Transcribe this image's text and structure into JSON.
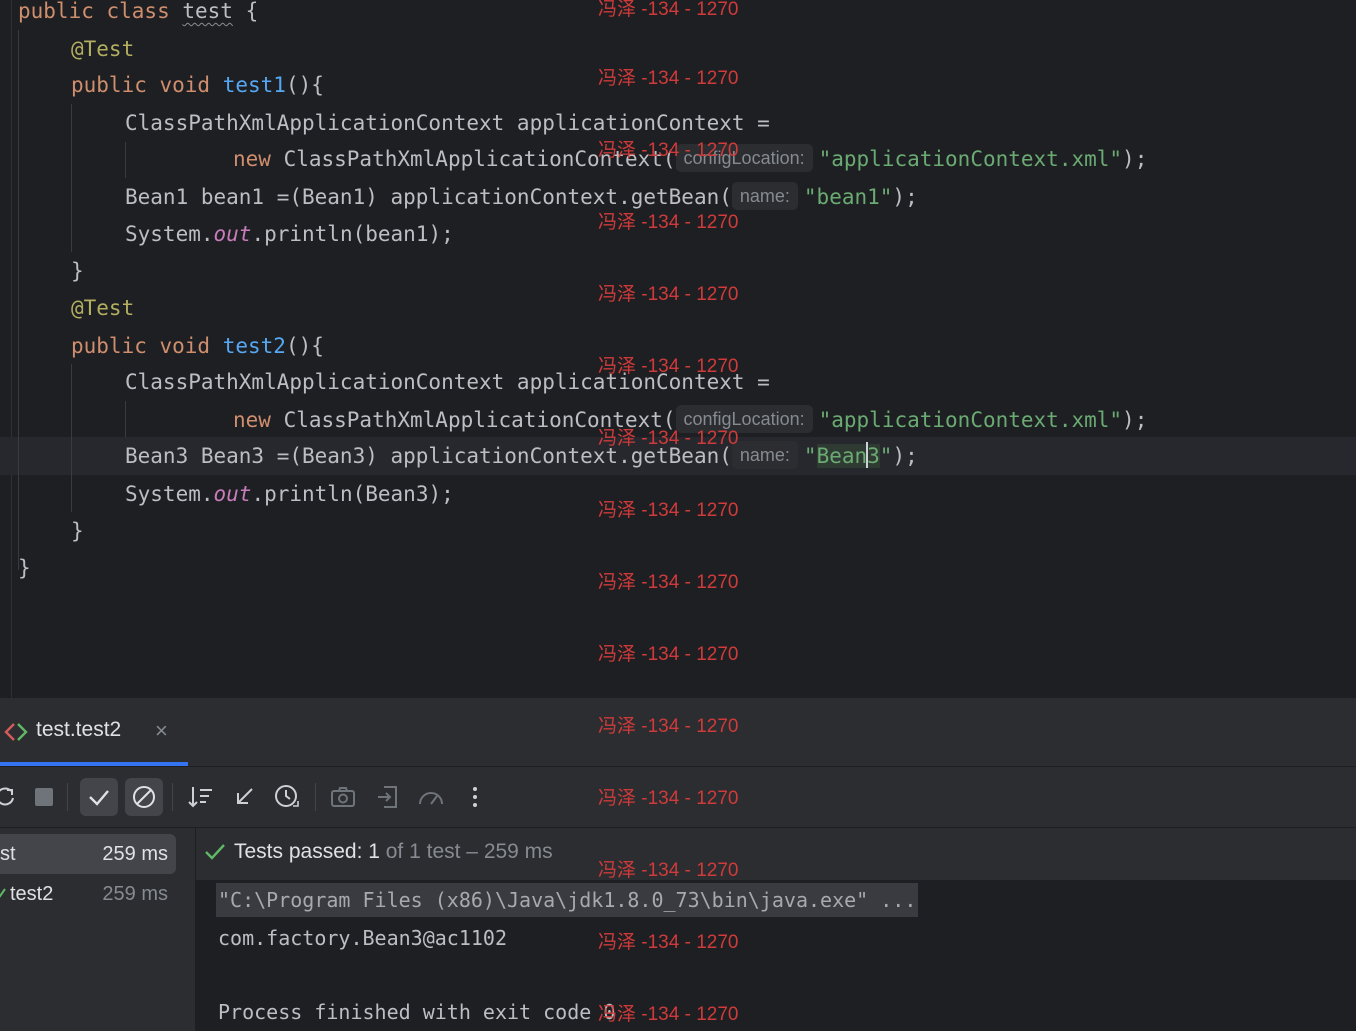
{
  "editor": {
    "class_line": {
      "kw": "public class ",
      "name": "test",
      "rest": " {"
    },
    "method1": {
      "annotation": "@Test",
      "sig_kw": "public void ",
      "sig_name": "test1",
      "sig_rest": "(){",
      "decl": "ClassPathXmlApplicationContext applicationContext =",
      "new_kw": "new ",
      "new_rest": "ClassPathXmlApplicationContext(",
      "hint_config": "configLocation:",
      "config_str": "\"applicationContext.xml\"",
      "stmt_end": ");",
      "getbean_pre": "Bean1 bean1 =(Bean1) applicationContext.getBean(",
      "hint_name": "name:",
      "bean_str": "\"bean1\"",
      "print_pre": "System.",
      "print_field": "out",
      "print_rest": ".println(bean1);",
      "close": "}"
    },
    "method2": {
      "annotation": "@Test",
      "sig_kw": "public void ",
      "sig_name": "test2",
      "sig_rest": "(){",
      "decl": "ClassPathXmlApplicationContext applicationContext =",
      "new_kw": "new ",
      "new_rest": "ClassPathXmlApplicationContext(",
      "hint_config": "configLocation:",
      "config_str": "\"applicationContext.xml\"",
      "stmt_end": ");",
      "getbean_pre": "Bean3 Bean3 =(Bean3) applicationContext.getBean(",
      "hint_name": "name:",
      "bean_quote_open": "\"",
      "bean_str_a": "Bean",
      "bean_str_b": "3",
      "bean_quote_close": "\"",
      "print_pre": "System.",
      "print_field": "out",
      "print_rest": ".println(Bean3);",
      "close": "}"
    },
    "class_close": "}"
  },
  "run_panel": {
    "tab_label": "test.test2",
    "tab_close": "×",
    "toolbar_icons": [
      "rerun-icon",
      "stop-icon",
      "show-passed-icon",
      "show-ignored-icon",
      "sort-icon",
      "collapse-icon",
      "history-icon",
      "camera-icon",
      "export-icon",
      "coverage-icon",
      "more-icon"
    ],
    "tree": [
      {
        "name": "st",
        "time": "259 ms"
      },
      {
        "name": "test2",
        "time": "259 ms"
      }
    ],
    "status_main": "Tests passed: 1",
    "status_dim": " of 1 test – 259 ms",
    "console": {
      "cmd": "\"C:\\Program Files (x86)\\Java\\jdk1.8.0_73\\bin\\java.exe\" ...",
      "output": "com.factory.Bean3@ac1102",
      "exit": "Process finished with exit code 0"
    }
  },
  "watermark": "冯泽 -134 - 1270",
  "colors": {
    "background": "#1e1f22",
    "panel": "#2b2d30",
    "keyword": "#cf8e6d",
    "annotation": "#b3ae60",
    "function": "#56a8f5",
    "string": "#6aab73",
    "field": "#c77dbb",
    "pass_green": "#5fb865",
    "accent_blue": "#3574f0",
    "watermark_red": "#d03a3a"
  }
}
